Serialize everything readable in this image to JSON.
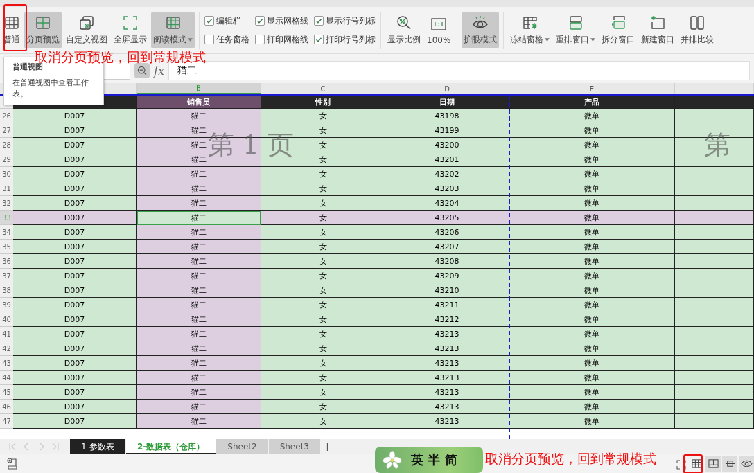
{
  "toolbar": {
    "view_buttons": [
      {
        "label": "普通",
        "selected": false
      },
      {
        "label": "分页预览",
        "selected": true
      },
      {
        "label": "自定义视图",
        "selected": false
      },
      {
        "label": "全屏显示",
        "selected": false
      },
      {
        "label": "阅读模式",
        "selected": true,
        "dropdown": true
      }
    ],
    "checkboxes": [
      {
        "label": "编辑栏",
        "checked": true
      },
      {
        "label": "任务窗格",
        "checked": false
      },
      {
        "label": "显示网格线",
        "checked": true
      },
      {
        "label": "打印网格线",
        "checked": false
      },
      {
        "label": "显示行号列标",
        "checked": true
      },
      {
        "label": "打印行号列标",
        "checked": true
      }
    ],
    "zoom_buttons": [
      {
        "label": "显示比例"
      },
      {
        "label": "100%"
      }
    ],
    "eye_button": {
      "label": "护眼模式",
      "selected": true
    },
    "window_buttons": [
      {
        "label": "冻结窗格",
        "dropdown": true
      },
      {
        "label": "重排窗口",
        "dropdown": true
      },
      {
        "label": "拆分窗口",
        "dropdown": false
      },
      {
        "label": "新建窗口",
        "dropdown": false
      },
      {
        "label": "并排比较",
        "dropdown": false
      }
    ]
  },
  "tooltip": {
    "title": "普通视图",
    "text": "在普通视图中查看工作表。"
  },
  "annotations": [
    {
      "text": "取消分页预览，回到常规模式"
    },
    {
      "text": "取消分页预览，回到常规模式"
    }
  ],
  "formula_bar": {
    "fx": "fx",
    "value": "猫二"
  },
  "column_letters": [
    "B",
    "C",
    "D",
    "E"
  ],
  "table": {
    "headers": [
      "销售员",
      "性别",
      "日期",
      "产品"
    ],
    "rows": [
      {
        "num": "26",
        "cells": [
          "D007",
          "猫二",
          "女",
          "43198",
          "微单"
        ],
        "selected": false
      },
      {
        "num": "27",
        "cells": [
          "D007",
          "猫二",
          "女",
          "43199",
          "微单"
        ],
        "selected": false
      },
      {
        "num": "28",
        "cells": [
          "D007",
          "猫二",
          "女",
          "43200",
          "微单"
        ],
        "selected": false
      },
      {
        "num": "29",
        "cells": [
          "D007",
          "猫二",
          "女",
          "43201",
          "微单"
        ],
        "selected": false
      },
      {
        "num": "30",
        "cells": [
          "D007",
          "猫二",
          "女",
          "43202",
          "微单"
        ],
        "selected": false
      },
      {
        "num": "31",
        "cells": [
          "D007",
          "猫二",
          "女",
          "43203",
          "微单"
        ],
        "selected": false
      },
      {
        "num": "32",
        "cells": [
          "D007",
          "猫二",
          "女",
          "43204",
          "微单"
        ],
        "selected": false
      },
      {
        "num": "33",
        "cells": [
          "D007",
          "猫二",
          "女",
          "43205",
          "微单"
        ],
        "selected": true
      },
      {
        "num": "34",
        "cells": [
          "D007",
          "猫二",
          "女",
          "43206",
          "微单"
        ],
        "selected": false
      },
      {
        "num": "35",
        "cells": [
          "D007",
          "猫二",
          "女",
          "43207",
          "微单"
        ],
        "selected": false
      },
      {
        "num": "36",
        "cells": [
          "D007",
          "猫二",
          "女",
          "43208",
          "微单"
        ],
        "selected": false
      },
      {
        "num": "37",
        "cells": [
          "D007",
          "猫二",
          "女",
          "43209",
          "微单"
        ],
        "selected": false
      },
      {
        "num": "38",
        "cells": [
          "D007",
          "猫二",
          "女",
          "43210",
          "微单"
        ],
        "selected": false
      },
      {
        "num": "39",
        "cells": [
          "D007",
          "猫二",
          "女",
          "43211",
          "微单"
        ],
        "selected": false
      },
      {
        "num": "40",
        "cells": [
          "D007",
          "猫二",
          "女",
          "43212",
          "微单"
        ],
        "selected": false
      },
      {
        "num": "41",
        "cells": [
          "D007",
          "猫二",
          "女",
          "43213",
          "微单"
        ],
        "selected": false
      },
      {
        "num": "42",
        "cells": [
          "D007",
          "猫二",
          "女",
          "43213",
          "微单"
        ],
        "selected": false
      },
      {
        "num": "43",
        "cells": [
          "D007",
          "猫二",
          "女",
          "43213",
          "微单"
        ],
        "selected": false
      },
      {
        "num": "44",
        "cells": [
          "D007",
          "猫二",
          "女",
          "43213",
          "微单"
        ],
        "selected": false
      },
      {
        "num": "45",
        "cells": [
          "D007",
          "猫二",
          "女",
          "43213",
          "微单"
        ],
        "selected": false
      },
      {
        "num": "46",
        "cells": [
          "D007",
          "猫二",
          "女",
          "43213",
          "微单"
        ],
        "selected": false
      },
      {
        "num": "47",
        "cells": [
          "D007",
          "猫二",
          "女",
          "43213",
          "微单"
        ],
        "selected": false
      }
    ]
  },
  "page_labels": [
    "第 1 页",
    "第"
  ],
  "sheet_tabs": [
    {
      "label": "1-参数表",
      "selected": false,
      "color": "#222222"
    },
    {
      "label": "2-数据表（仓库）",
      "selected": true,
      "color": "#ffffff"
    },
    {
      "label": "Sheet2",
      "selected": false,
      "color": "#d0d0d0"
    },
    {
      "label": "Sheet3",
      "selected": false,
      "color": "#d0d0d0"
    }
  ],
  "ime_bar": {
    "text": "英 半 简"
  },
  "status_views": [
    {
      "selected": true
    },
    {
      "selected": false
    },
    {
      "selected": false
    },
    {
      "selected": false
    }
  ]
}
